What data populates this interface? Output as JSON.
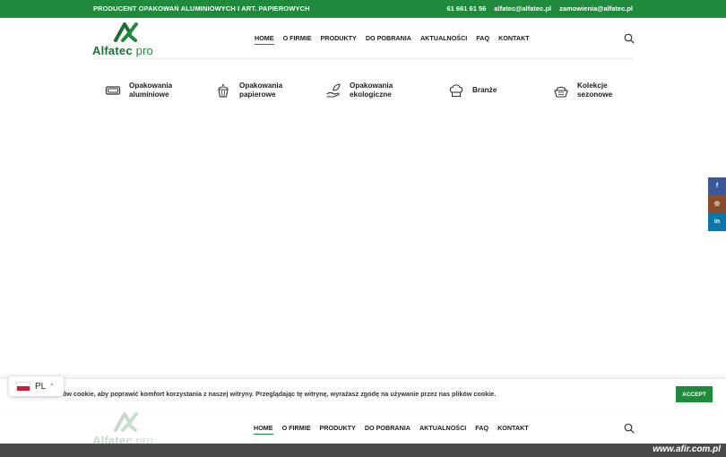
{
  "topbar": {
    "tagline": "PRODUCENT OPAKOWAŃ ALUMINIOWYCH I ART. PAPIEROWYCH",
    "phone": "61 661 61 56",
    "email1": "alfatec@alfatec.pl",
    "email2": "zamowienia@alfatec.pl",
    "bg_color": "#1f8a3c"
  },
  "logo": {
    "name": "Alfatec",
    "suffix": "pro"
  },
  "nav": {
    "items": [
      {
        "label": "HOME",
        "active": true
      },
      {
        "label": "O FIRMIE"
      },
      {
        "label": "PRODUKTY"
      },
      {
        "label": "DO POBRANIA"
      },
      {
        "label": "AKTUALNOŚCI"
      },
      {
        "label": "FAQ"
      },
      {
        "label": "KONTAKT"
      }
    ],
    "search_icon": "search-icon"
  },
  "categories": [
    {
      "label": "Opakowania aluminiowe",
      "icon": "tray-icon"
    },
    {
      "label": "Opakowania papierowe",
      "icon": "cupcake-icon"
    },
    {
      "label": "Opakowania ekologiczne",
      "icon": "leaf-hand-icon"
    },
    {
      "label": "Branże",
      "icon": "chef-hat-icon"
    },
    {
      "label": "Kolekcje sezonowe",
      "icon": "season-basket-icon"
    }
  ],
  "social": [
    {
      "label": "f",
      "icon": "facebook-icon",
      "color": "#3b5998"
    },
    {
      "label": "◎",
      "icon": "instagram-icon",
      "color": "#8a4b2a"
    },
    {
      "label": "in",
      "icon": "linkedin-icon",
      "color": "#0e76a8"
    }
  ],
  "cookie": {
    "text": "ów cookie, aby poprawić komfort korzystania z naszej witryny. Przeglądając tę witrynę, wyrażasz zgodę na używanie przez nas plików cookie.",
    "accept_label": "ACCEPT"
  },
  "language": {
    "code": "PL",
    "caret": "^"
  },
  "watermark": {
    "text": "www.afir.com.pl"
  },
  "colors": {
    "brand_green": "#1f8a3c",
    "dark_green": "#1f6b35"
  }
}
